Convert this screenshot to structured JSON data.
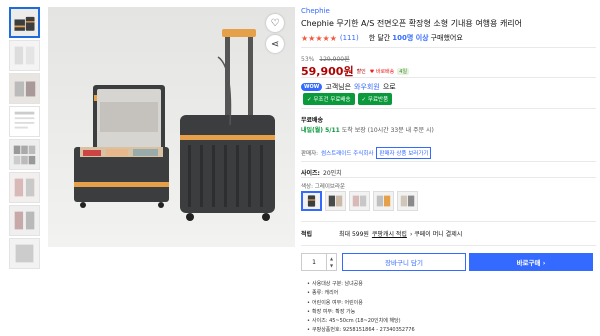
{
  "product": {
    "brand": "Chephie",
    "title": "Chephie 무기한 A/S 전면오픈 확장형 소형 기내용 여행용 캐리어",
    "stars": "★★★★★",
    "review_count": "(111)",
    "sold_prefix": "한 달간",
    "sold_count": "100명 이상",
    "sold_suffix": "구매했어요"
  },
  "price": {
    "discount_rate": "53%",
    "original": "129,900원",
    "sale": "59,900원",
    "tag": "할인",
    "tag2": "♥ 바로배송",
    "badge": "4일"
  },
  "membership": {
    "wow_label": "WOW",
    "text_prefix": "고객님은",
    "text_highlight": "와우회원",
    "text_suffix": "으로",
    "pill1": "✓ 무조건 무료배송",
    "pill2": "✓ 무료반품"
  },
  "shipping": {
    "label": "무료배송",
    "date_highlight": "내일(월) 5/11",
    "date_suffix": "도착 보장 (10시간 33분 내 주문 시)"
  },
  "seller": {
    "label": "판매자:",
    "name": "썸스트래이드 주식회사",
    "button": "판매자 상품 보러가기"
  },
  "options": {
    "size_label": "사이즈:",
    "size_value": "20인치",
    "color_label": "색상: 그레이브라운"
  },
  "cash": {
    "label": "적립",
    "prefix": "최대 599원",
    "link": "쿠팡캐시 적립",
    "suffix": "› 쿠페이 머니 결제시"
  },
  "purchase": {
    "quantity": "1",
    "cart_label": "장바구니 담기",
    "buy_label": "바로구매 ›"
  },
  "specs": [
    "사용대상 구분: 남녀공용",
    "종류: 캐리어",
    "어린이용 여부: 어린이용",
    "확장 여부: 확장 가능",
    "사이즈: 45~50cm (18~20인치에 해당)",
    "쿠팡상품번호: 9258151864 - 27340352776"
  ],
  "colors": {
    "accent": "#346aff",
    "price": "#ae0000",
    "green": "#0a9a3c",
    "luggage_body": "#3b3d3f",
    "luggage_trim": "#e6a04a"
  },
  "icons": {
    "wishlist": "heart-icon",
    "share": "share-icon"
  }
}
